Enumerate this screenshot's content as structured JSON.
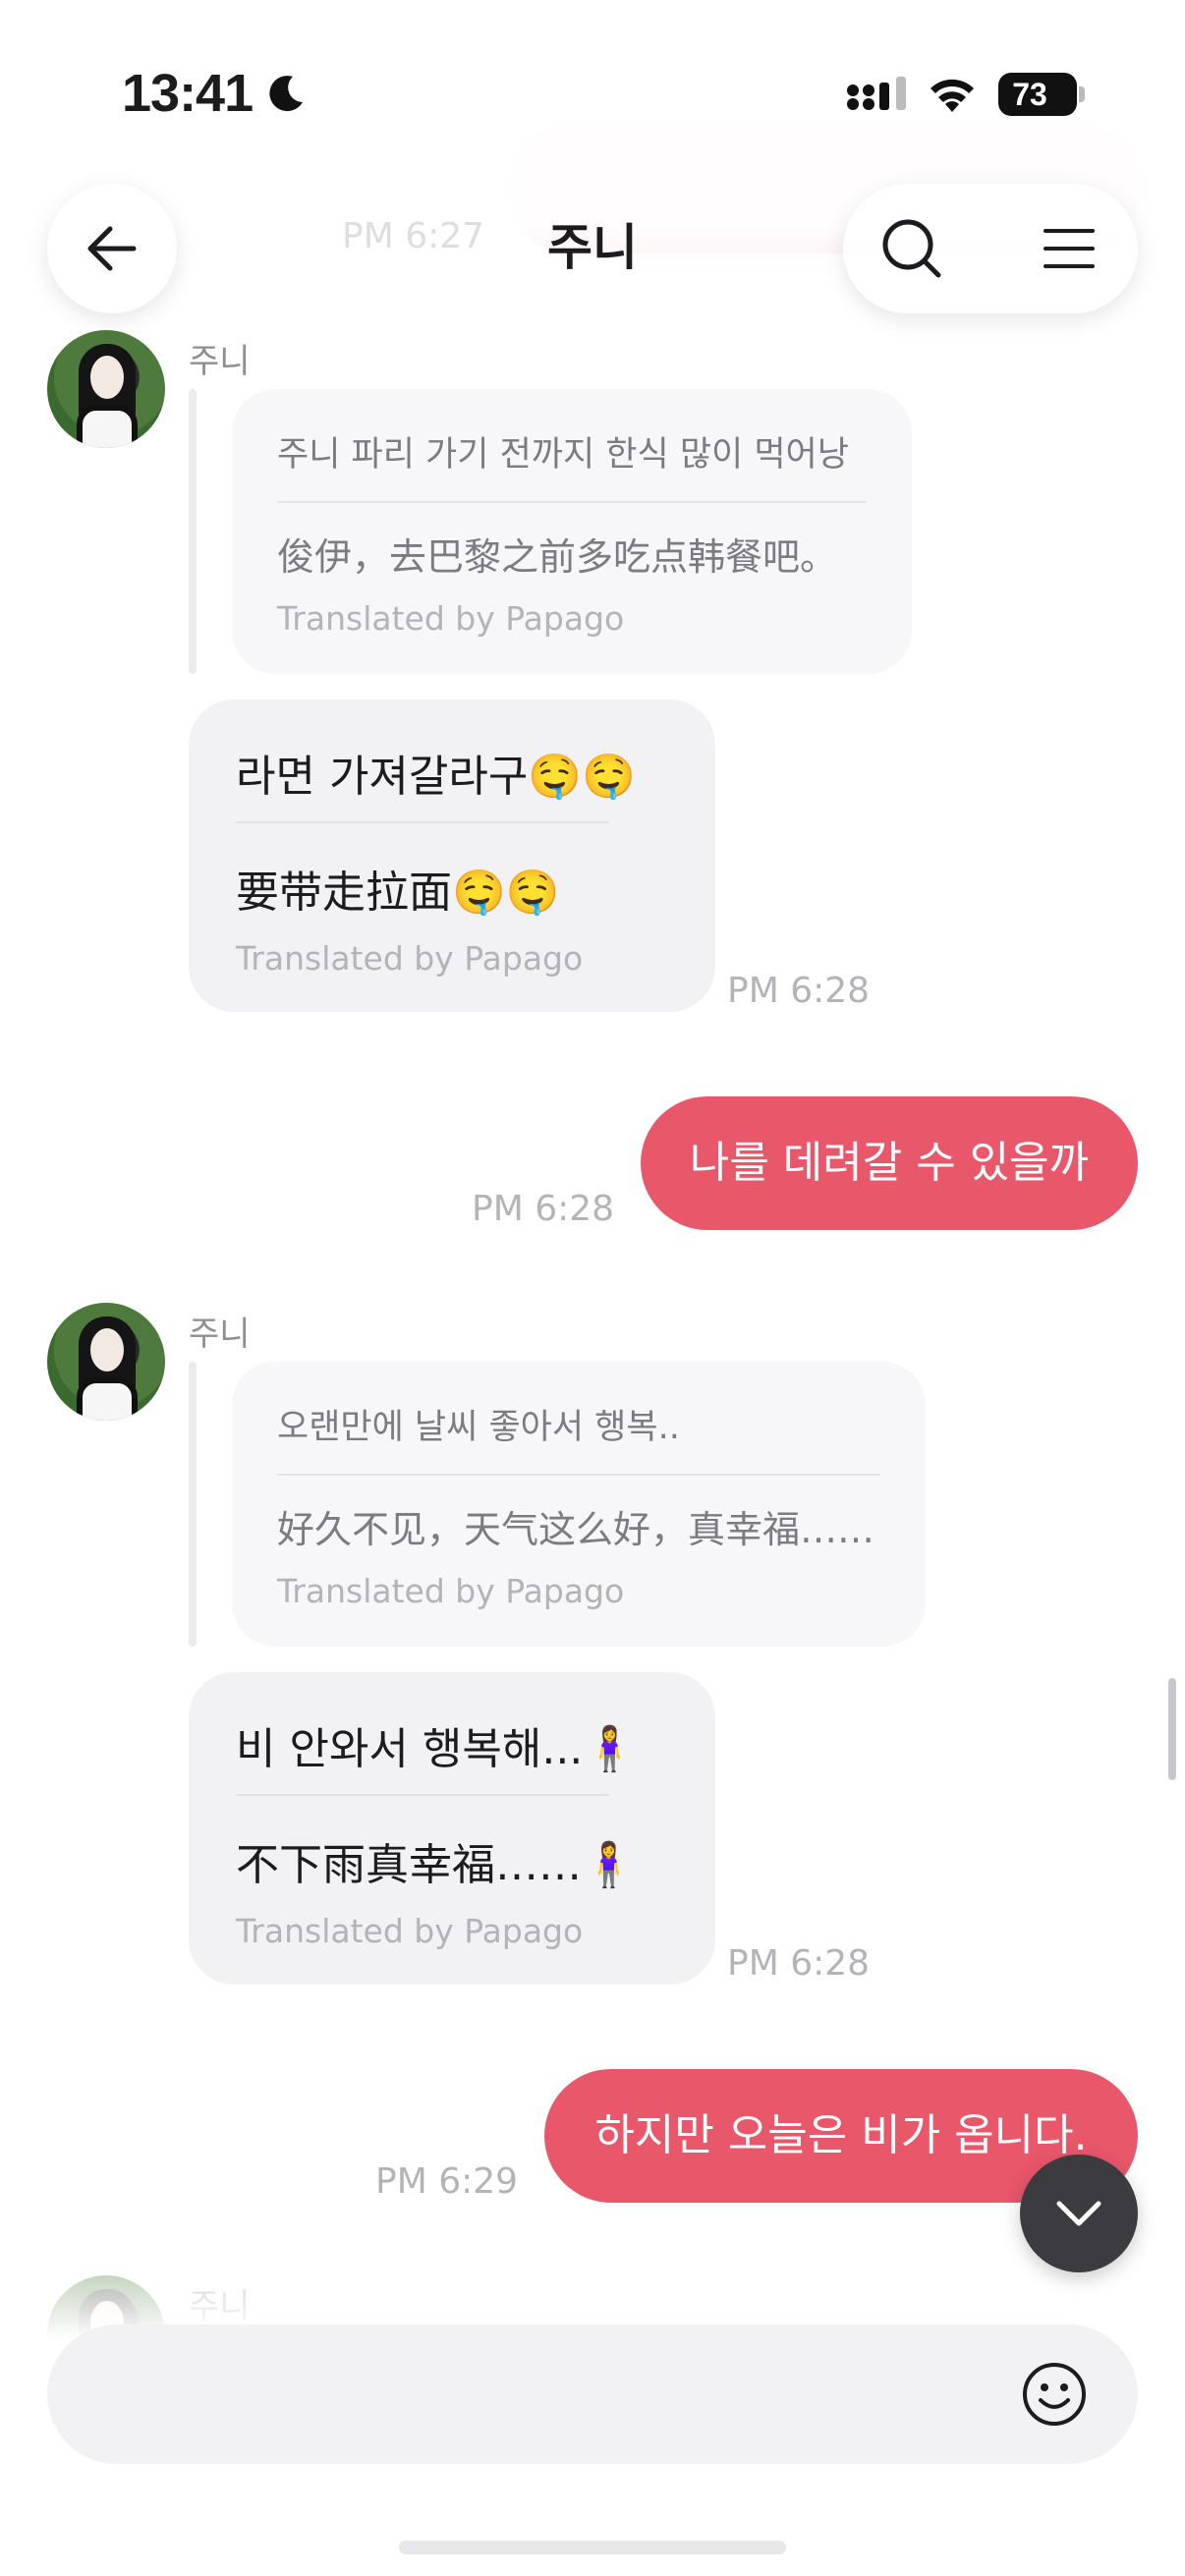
{
  "status_bar": {
    "time": "13:41",
    "battery": "73",
    "focus_icon": "moon-icon",
    "signal_icon": "cellular-signal-icon",
    "wifi_icon": "wifi-icon"
  },
  "header": {
    "title": "주니",
    "back_icon": "arrow-left-icon",
    "search_icon": "search-icon",
    "menu_icon": "hamburger-menu-icon",
    "blurred_timestamp": "PM 6:27"
  },
  "colors": {
    "accent": "#e9576b",
    "incoming_bubble": "#f2f2f4",
    "quote_card": "#f7f7f9",
    "scroll_button": "#3c3c40"
  },
  "messages": [
    {
      "sender": "주니",
      "quote": {
        "original": "주니 파리 가기 전까지 한식 많이 먹어낭",
        "translation": "俊伊，去巴黎之前多吃点韩餐吧。",
        "credit": "Translated by Papago"
      },
      "bubble": {
        "original": "라면 가져갈라구🤤🤤",
        "translation": "要带走拉面🤤🤤",
        "credit": "Translated by Papago"
      },
      "time": "PM 6:28"
    },
    {
      "outgoing_text": "나를 데려갈 수 있을까",
      "time": "PM 6:28"
    },
    {
      "sender": "주니",
      "quote": {
        "original": "오랜만에 날씨 좋아서 행복..",
        "translation": "好久不见，天气这么好，真幸福……",
        "credit": "Translated by Papago"
      },
      "bubble": {
        "original": "비 안와서 행복해...🧍‍♀️",
        "translation": "不下雨真幸福……🧍‍♀️",
        "credit": "Translated by Papago"
      },
      "time": "PM 6:28"
    },
    {
      "outgoing_text": "하지만 오늘은 비가 옵니다.",
      "time": "PM 6:29"
    },
    {
      "sender": "주니"
    }
  ],
  "composer": {
    "placeholder": "",
    "emoji_icon": "smiley-face-icon"
  },
  "scroll_down_icon": "chevron-down-icon"
}
